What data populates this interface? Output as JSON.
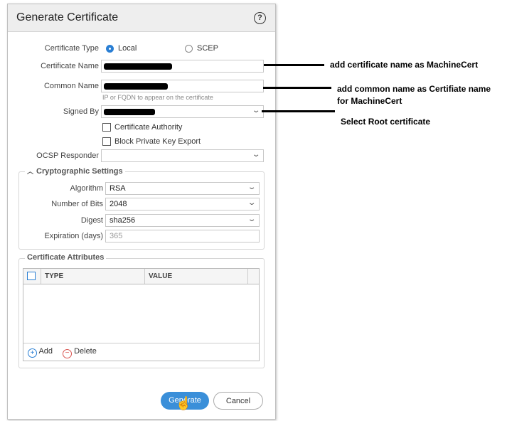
{
  "dialog": {
    "title": "Generate Certificate",
    "help_icon": "question-circle-icon"
  },
  "form": {
    "certificate_type": {
      "label": "Certificate Type",
      "options": [
        "Local",
        "SCEP"
      ],
      "selected": "Local"
    },
    "certificate_name": {
      "label": "Certificate Name"
    },
    "common_name": {
      "label": "Common Name",
      "hint": "IP or FQDN to appear on the certificate"
    },
    "signed_by": {
      "label": "Signed By"
    },
    "certificate_authority": {
      "label": "Certificate Authority",
      "checked": false
    },
    "block_private_key": {
      "label": "Block Private Key Export",
      "checked": false
    },
    "ocsp_responder": {
      "label": "OCSP Responder",
      "value": ""
    }
  },
  "crypto": {
    "title": "Cryptographic Settings",
    "algorithm": {
      "label": "Algorithm",
      "value": "RSA"
    },
    "bits": {
      "label": "Number of Bits",
      "value": "2048"
    },
    "digest": {
      "label": "Digest",
      "value": "sha256"
    },
    "expiration": {
      "label": "Expiration (days)",
      "placeholder": "365"
    }
  },
  "attributes": {
    "title": "Certificate Attributes",
    "columns": [
      "TYPE",
      "VALUE"
    ],
    "add_label": "Add",
    "delete_label": "Delete"
  },
  "buttons": {
    "generate": "Generate",
    "cancel": "Cancel"
  },
  "annotations": [
    "add certificate name as MachineCert",
    "add common name as Certifiate name for MachineCert",
    "Select Root certificate"
  ],
  "colors": {
    "accent": "#2a7fd4",
    "generate_button": "#3a8fd9",
    "delete_icon": "#d9534f"
  }
}
